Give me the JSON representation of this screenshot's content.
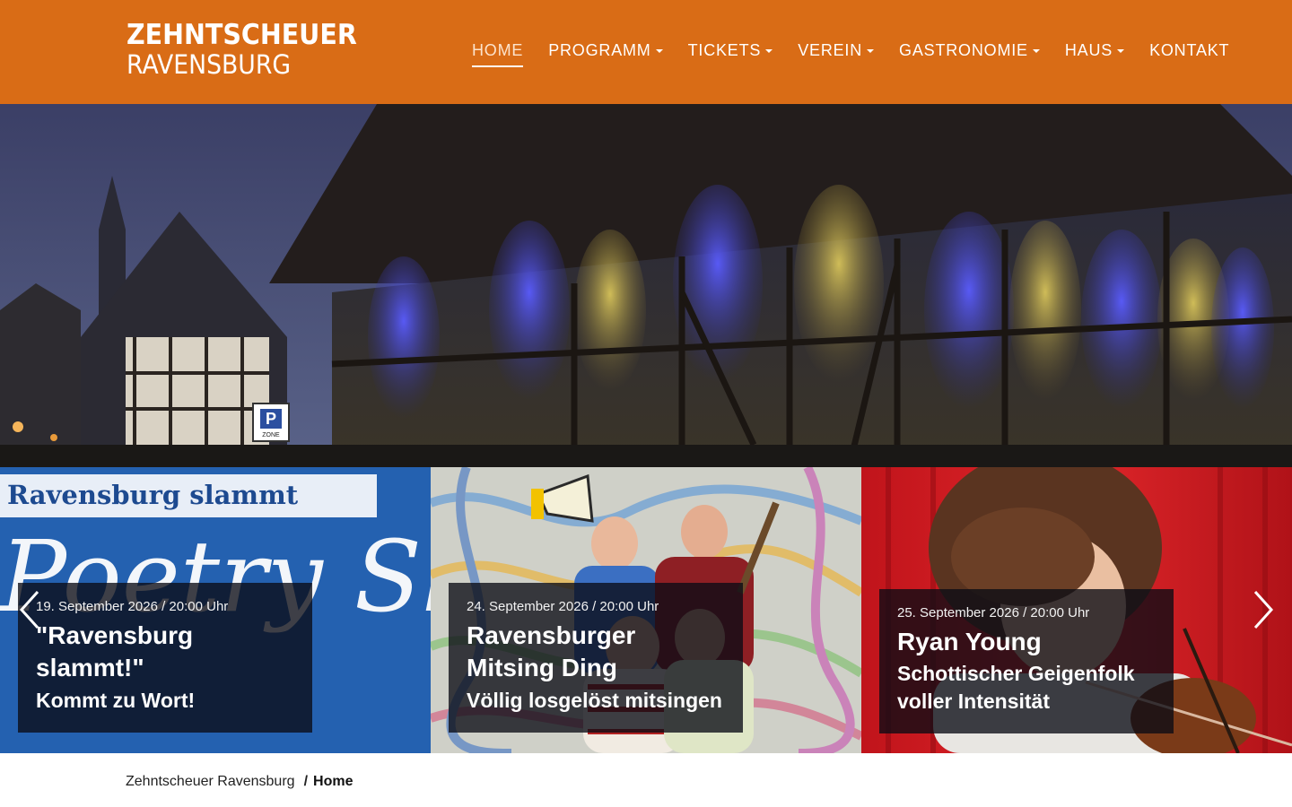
{
  "header": {
    "logo_line1": "ZEHNTSCHEUER",
    "logo_line2": "RAVENSBURG",
    "background_color": "#d96c16",
    "nav": [
      {
        "label": "HOME",
        "active": true,
        "dropdown": false
      },
      {
        "label": "PROGRAMM",
        "active": false,
        "dropdown": true
      },
      {
        "label": "TICKETS",
        "active": false,
        "dropdown": true
      },
      {
        "label": "VEREIN",
        "active": false,
        "dropdown": true
      },
      {
        "label": "GASTRONOMIE",
        "active": false,
        "dropdown": true
      },
      {
        "label": "HAUS",
        "active": false,
        "dropdown": true
      },
      {
        "label": "KONTAKT",
        "active": false,
        "dropdown": false
      }
    ]
  },
  "events": [
    {
      "date": "19. September 2026 / 20:00 Uhr",
      "title": "\"Ravensburg slammt!\"",
      "subtitle": "Kommt zu Wort!",
      "poster_heading": "Ravensburg slammt",
      "poster_script": "Poetry Slam",
      "color": "#1f5aa8"
    },
    {
      "date": "24. September 2026 / 20:00 Uhr",
      "title": "Ravensburger Mitsing Ding",
      "subtitle": "Völlig losgelöst mitsingen",
      "color": "#c9c7c0"
    },
    {
      "date": "25. September 2026 / 20:00 Uhr",
      "title": "Ryan Young",
      "subtitle": "Schottischer Geigenfolk voller Intensität",
      "color": "#c4161c"
    }
  ],
  "slider": {
    "prev_icon": "chevron-left-icon",
    "next_icon": "chevron-right-icon"
  },
  "hero": {
    "sign_letter": "P",
    "sign_zone": "ZONE"
  },
  "breadcrumb": {
    "parent": "Zehntscheuer Ravensburg",
    "separator": "/",
    "current": "Home"
  }
}
